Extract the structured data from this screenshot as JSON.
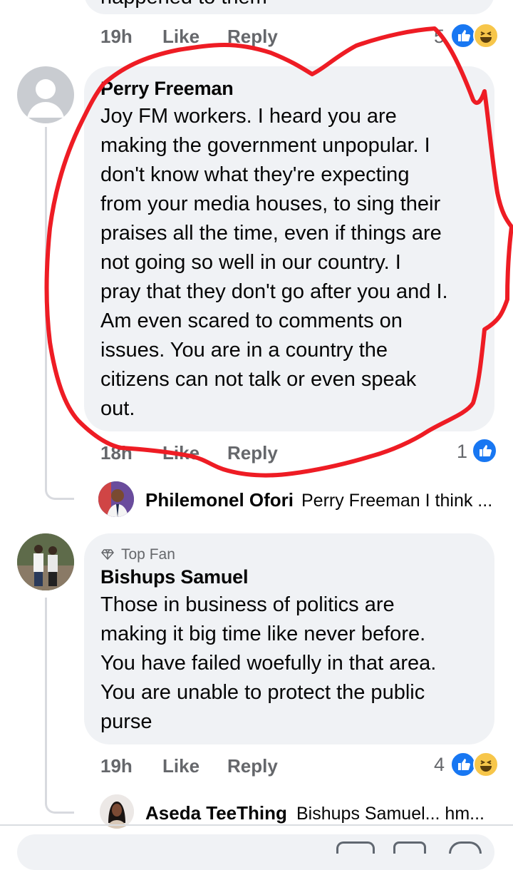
{
  "prev_comment": {
    "partial_text": "happened to them",
    "time": "19h",
    "like": "Like",
    "reply": "Reply",
    "reaction_count": "5"
  },
  "comment1": {
    "author": "Perry Freeman",
    "text": "Joy FM workers. I heard you are\nmaking the government unpopular. I\ndon't know what they're expecting\nfrom your media houses, to sing their\npraises all the time, even if things are\nnot going so well in our country. I\npray that they don't go after you and I.\nAm even scared to comments on\nissues. You are in a country the\ncitizens can not talk or even speak\nout.",
    "time": "18h",
    "like": "Like",
    "reply": "Reply",
    "reaction_count": "1",
    "reply_preview": {
      "author": "Philemonel Ofori",
      "text": "Perry Freeman I think ..."
    }
  },
  "comment2": {
    "badge": "Top Fan",
    "author": "Bishups Samuel",
    "text": "Those in business of politics are\nmaking it big time like never before.\nYou have failed woefully in that area.\nYou are unable to protect the public\npurse",
    "time": "19h",
    "like": "Like",
    "reply": "Reply",
    "reaction_count": "4",
    "reply_preview": {
      "author": "Aseda TeeThing",
      "text": "Bishups Samuel...  hm..."
    }
  },
  "colors": {
    "bubble": "#f0f2f5",
    "meta_text": "#65676b",
    "like_blue": "#1877f2",
    "annotation_red": "#ee1c24"
  }
}
